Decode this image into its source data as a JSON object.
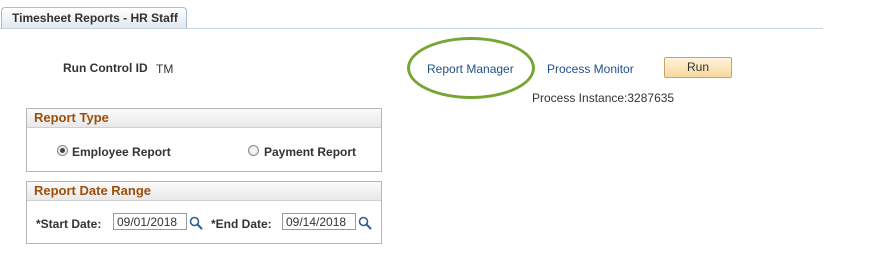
{
  "tab": {
    "label": "Timesheet Reports - HR Staff"
  },
  "run_control": {
    "label": "Run Control ID",
    "value": "TM"
  },
  "links": {
    "report_manager": "Report Manager",
    "process_monitor": "Process Monitor"
  },
  "run_button": {
    "label": "Run"
  },
  "process_instance": "Process Instance:3287635",
  "report_type": {
    "title": "Report Type",
    "options": [
      {
        "label": "Employee Report",
        "selected": true
      },
      {
        "label": "Payment Report",
        "selected": false
      }
    ]
  },
  "date_range": {
    "title": "Report Date Range",
    "start_label": "*Start Date:",
    "start_value": "09/01/2018",
    "end_label": "*End Date:",
    "end_value": "09/14/2018"
  },
  "icons": {
    "lookup": "search-icon",
    "highlight": "highlight-oval"
  },
  "colors": {
    "highlight": "#78a636",
    "link": "#1f4f8a",
    "group_title": "#9c4f0b"
  }
}
